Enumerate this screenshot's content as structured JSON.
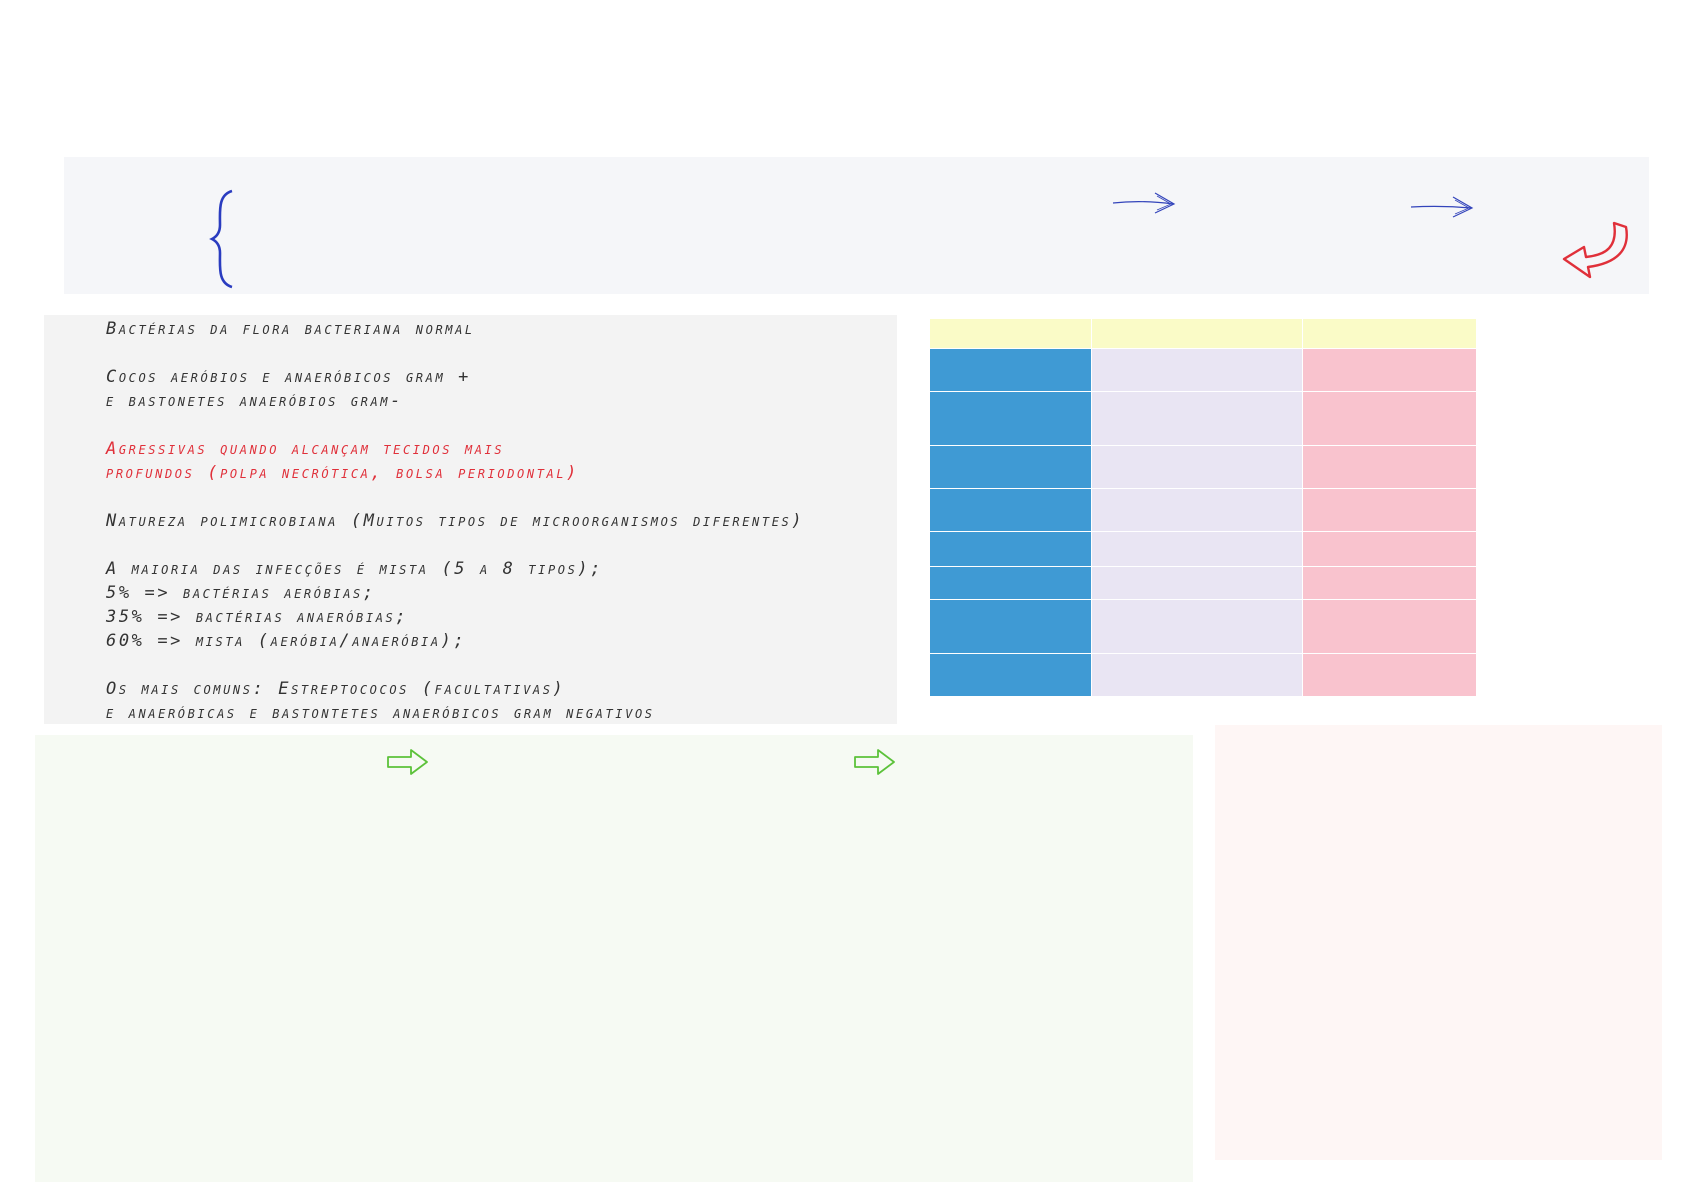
{
  "notes": {
    "line1": "Bactérias da flora bacteriana normal",
    "line2": "Cocos aeróbios e anaeróbicos gram +",
    "line3": "e bastonetes anaeróbios gram-",
    "line4": "Agressivas quando alcançam tecidos mais",
    "line5": "profundos (polpa necrótica, bolsa periodontal)",
    "line6": "Natureza polimicrobiana (Muitos tipos de microorganismos diferentes)",
    "line7": "A maioria das infecções é mista (5 a 8 tipos);",
    "line8": "5% => bactérias aeróbias;",
    "line9": "35% => bactérias anaeróbias;",
    "line10": "60% => mista (aeróbia/anaeróbia);",
    "line11": "Os mais comuns: Estreptococos (facultativas)",
    "line12": "e anaeróbicas e bastontetes anaeróbicos gram negativos"
  },
  "colors": {
    "accent_red": "#e0303a",
    "pen_blue": "#2a3cc0",
    "pen_green": "#5cc23a",
    "table_blue": "#3f9ad4",
    "table_lavender": "#e9e5f3",
    "table_pink": "#f9c3ce",
    "table_header": "#fafbc7"
  },
  "icons": {
    "banner": [
      "brace-icon",
      "arrow-right-icon",
      "arrow-right-icon",
      "curved-arrow-icon"
    ],
    "green_panel": [
      "outline-arrow-icon",
      "outline-arrow-icon"
    ]
  }
}
